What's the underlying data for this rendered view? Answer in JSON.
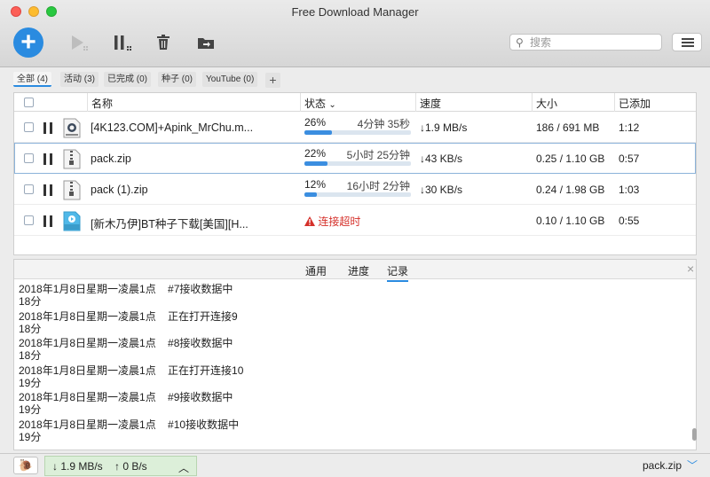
{
  "window": {
    "title": "Free Download Manager"
  },
  "toolbar": {
    "add_label": "+",
    "search_placeholder": "搜索"
  },
  "filters": [
    {
      "label": "全部 (4)",
      "active": true
    },
    {
      "label": "活动 (3)",
      "active": false
    },
    {
      "label": "已完成 (0)",
      "active": false
    },
    {
      "label": "种子 (0)",
      "active": false
    },
    {
      "label": "YouTube (0)",
      "active": false
    }
  ],
  "filter_add": "+",
  "table": {
    "headers": {
      "name": "名称",
      "status": "状态",
      "sort_indicator": "⌄",
      "speed": "速度",
      "size": "大小",
      "added": "已添加"
    },
    "rows": [
      {
        "name": "[4K123.COM]+Apink_MrChu.m...",
        "icon": "mpeg4-file-icon",
        "percent": "26%",
        "progress": 0.26,
        "eta": "4分钟 35秒",
        "speed": "↓1.9 MB/s",
        "size": "186 / 691 MB",
        "added": "1:12",
        "error": null
      },
      {
        "name": "pack.zip",
        "icon": "zip-file-icon",
        "percent": "22%",
        "progress": 0.22,
        "eta": "5小时 25分钟",
        "speed": "↓43 KB/s",
        "size": "0.25 / 1.10 GB",
        "added": "0:57",
        "error": null
      },
      {
        "name": "pack (1).zip",
        "icon": "zip-file-icon",
        "percent": "12%",
        "progress": 0.12,
        "eta": "16小时 2分钟",
        "speed": "↓30 KB/s",
        "size": "0.24 / 1.98 GB",
        "added": "1:03",
        "error": null
      },
      {
        "name": "[新木乃伊]BT种子下载[美国][H...",
        "icon": "wmv-file-icon",
        "percent": "",
        "progress": 0,
        "eta": "",
        "speed": "",
        "size": "0.10 / 1.10 GB",
        "added": "0:55",
        "error": "连接超时"
      }
    ]
  },
  "detail": {
    "tabs": [
      "通用",
      "进度",
      "记录"
    ],
    "active_tab": "记录",
    "close": "×",
    "log": [
      {
        "line1": "2018年1月8日星期一凌晨1点    #7接收数据中",
        "line2": "18分"
      },
      {
        "line1": "2018年1月8日星期一凌晨1点    正在打开连接9",
        "line2": "18分"
      },
      {
        "line1": "2018年1月8日星期一凌晨1点    #8接收数据中",
        "line2": "18分"
      },
      {
        "line1": "2018年1月8日星期一凌晨1点    正在打开连接10",
        "line2": "19分"
      },
      {
        "line1": "2018年1月8日星期一凌晨1点    #9接收数据中",
        "line2": "19分"
      },
      {
        "line1": "2018年1月8日星期一凌晨1点    #10接收数据中",
        "line2": "19分"
      }
    ]
  },
  "statusbar": {
    "download_speed": "↓ 1.9 MB/s",
    "upload_speed": "↑ 0 B/s",
    "current_file": "pack.zip"
  },
  "colors": {
    "accent": "#2a8be0",
    "error": "#d5302a",
    "progress": "#3b8ee0",
    "speed_bg": "#dcefd9"
  }
}
